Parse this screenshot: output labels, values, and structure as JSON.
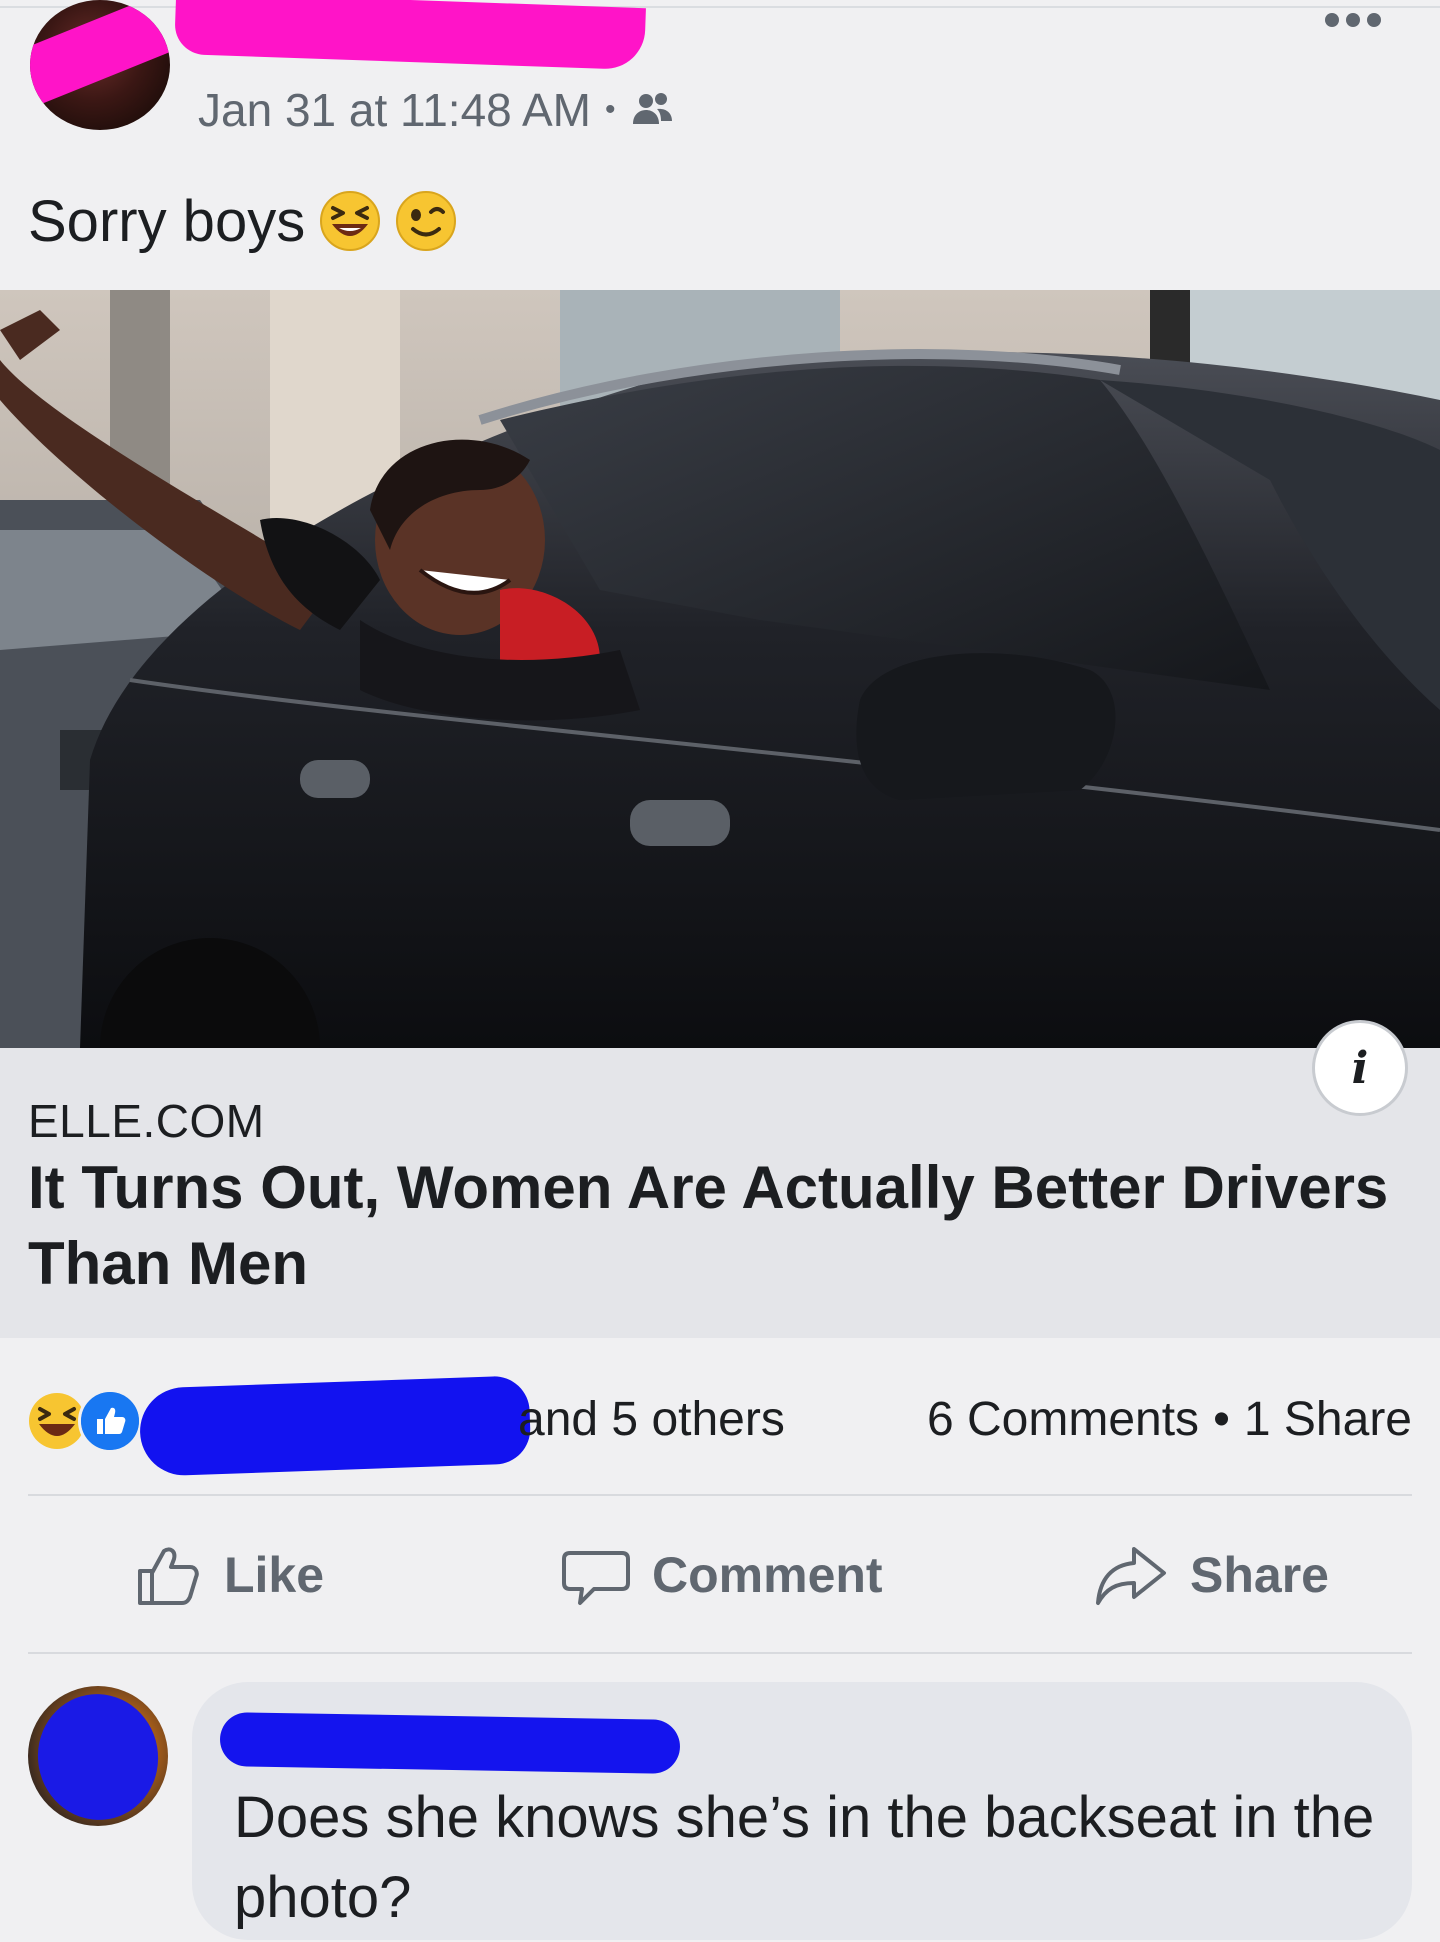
{
  "post": {
    "timestamp": "Jan 31 at 11:48 AM",
    "separator": "•",
    "audience_icon": "friends-icon",
    "text": "Sorry boys",
    "emojis": [
      "laughing-emoji",
      "winking-emoji"
    ]
  },
  "link_preview": {
    "domain": "ELLE.COM",
    "headline": "It Turns Out, Women Are Actually Better Drivers Than Men",
    "info_icon_glyph": "i"
  },
  "reactions": {
    "icons": [
      "haha-reaction-icon",
      "like-reaction-icon"
    ],
    "others_text": "and 5 others",
    "comments": "6 Comments",
    "separator": "•",
    "shares": "1 Share"
  },
  "actions": {
    "like": "Like",
    "comment": "Comment",
    "share": "Share"
  },
  "comment": {
    "text": "Does she knows she’s in the backseat in the photo?"
  },
  "colors": {
    "redaction_pink": "#ff14c8",
    "redaction_blue": "#1414ee",
    "like_blue": "#1877f2",
    "secondary_text": "#606770"
  }
}
